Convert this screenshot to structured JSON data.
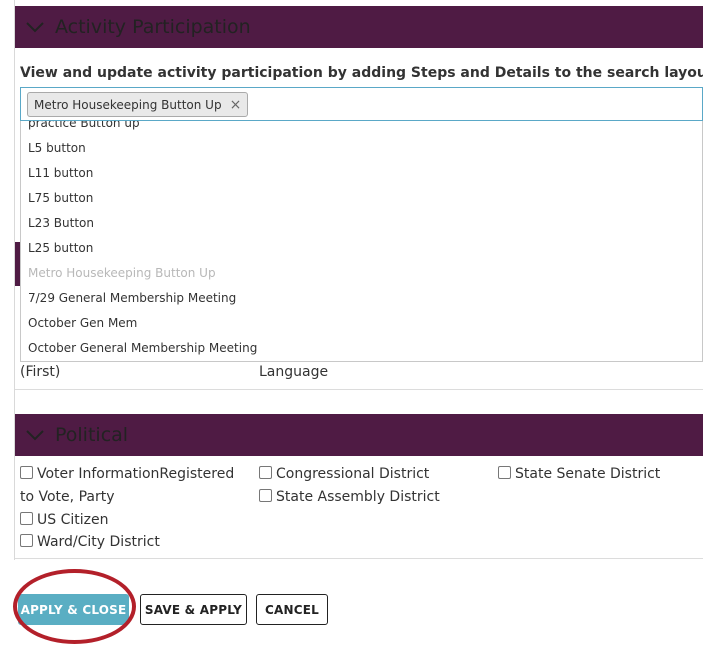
{
  "activity": {
    "header_title": "Activity Participation",
    "description": "View and update activity participation by adding Steps and Details to the search layout.",
    "selected_tag": "Metro Housekeeping Button Up",
    "tag_remove": "×",
    "options": [
      "practice Button up",
      "L5 button",
      "L11 button",
      "L75 button",
      "L23 Button",
      "L25 button",
      "Metro Housekeeping Button Up",
      "7/29 General Membership Meeting",
      "October Gen Mem",
      "October General Membership Meeting"
    ],
    "disabled_option": "Metro Housekeeping Button Up"
  },
  "hidden_row": {
    "left": "(First)",
    "right": "Language"
  },
  "political": {
    "header_title": "Political",
    "checkboxes": {
      "voter_line1": "Voter InformationRegistered",
      "voter_line2": "to Vote, Party",
      "us_citizen": "US Citizen",
      "ward_city": "Ward/City District",
      "congressional": "Congressional District",
      "state_assembly": "State Assembly District",
      "state_senate": "State Senate District"
    }
  },
  "buttons": {
    "apply_close": "APPLY & CLOSE",
    "save_apply": "SAVE & APPLY",
    "cancel": "CANCEL"
  },
  "colors": {
    "header_bg": "#4f1b44",
    "primary_button": "#5aaec3",
    "annotation_ring": "#b3202a",
    "focus_border": "#5aa8c7"
  },
  "icons": {
    "collapse": "chevron-down-icon",
    "device": "mobile-phone-icon",
    "remove": "close-icon"
  }
}
